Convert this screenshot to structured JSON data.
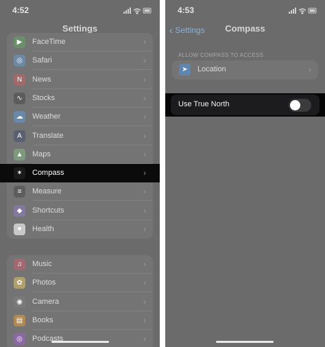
{
  "left_screen": {
    "status_time": "4:52",
    "title": "Settings",
    "group1": [
      {
        "label": "FaceTime",
        "icon": "facetime-icon",
        "color": "#6a8f6a",
        "glyph": "▶"
      },
      {
        "label": "Safari",
        "icon": "safari-icon",
        "color": "#6f88a3",
        "glyph": "◎"
      },
      {
        "label": "News",
        "icon": "news-icon",
        "color": "#a06a6a",
        "glyph": "N"
      },
      {
        "label": "Stocks",
        "icon": "stocks-icon",
        "color": "#5c5c5c",
        "glyph": "∿"
      },
      {
        "label": "Weather",
        "icon": "weather-icon",
        "color": "#6a88a8",
        "glyph": "☁"
      },
      {
        "label": "Translate",
        "icon": "translate-icon",
        "color": "#5a6070",
        "glyph": "A"
      },
      {
        "label": "Maps",
        "icon": "maps-icon",
        "color": "#7d9a7d",
        "glyph": "▲"
      },
      {
        "label": "Compass",
        "icon": "compass-icon",
        "color": "#1a1a1a",
        "glyph": "✶"
      },
      {
        "label": "Measure",
        "icon": "measure-icon",
        "color": "#5d5d5d",
        "glyph": "≡"
      },
      {
        "label": "Shortcuts",
        "icon": "shortcuts-icon",
        "color": "#8478a0",
        "glyph": "◆"
      },
      {
        "label": "Health",
        "icon": "health-icon",
        "color": "#c8c8c8",
        "glyph": "♥"
      }
    ],
    "group2": [
      {
        "label": "Music",
        "icon": "music-icon",
        "color": "#a06a70",
        "glyph": "♫"
      },
      {
        "label": "Photos",
        "icon": "photos-icon",
        "color": "#b0a070",
        "glyph": "✿"
      },
      {
        "label": "Camera",
        "icon": "camera-icon",
        "color": "#7a7a7a",
        "glyph": "◉"
      },
      {
        "label": "Books",
        "icon": "books-icon",
        "color": "#b08a55",
        "glyph": "▤"
      },
      {
        "label": "Podcasts",
        "icon": "podcasts-icon",
        "color": "#8a6aa0",
        "glyph": "◎"
      }
    ],
    "selected": "Compass"
  },
  "right_screen": {
    "status_time": "4:53",
    "back_label": "Settings",
    "title": "Compass",
    "section_header": "ALLOW COMPASS TO ACCESS",
    "location_label": "Location",
    "true_north_label": "Use True North",
    "true_north_enabled": false
  },
  "colors": {
    "dim_background": "#6b6b6b",
    "highlight": "#0b0b0b",
    "accent_link": "#8ab0d8"
  }
}
